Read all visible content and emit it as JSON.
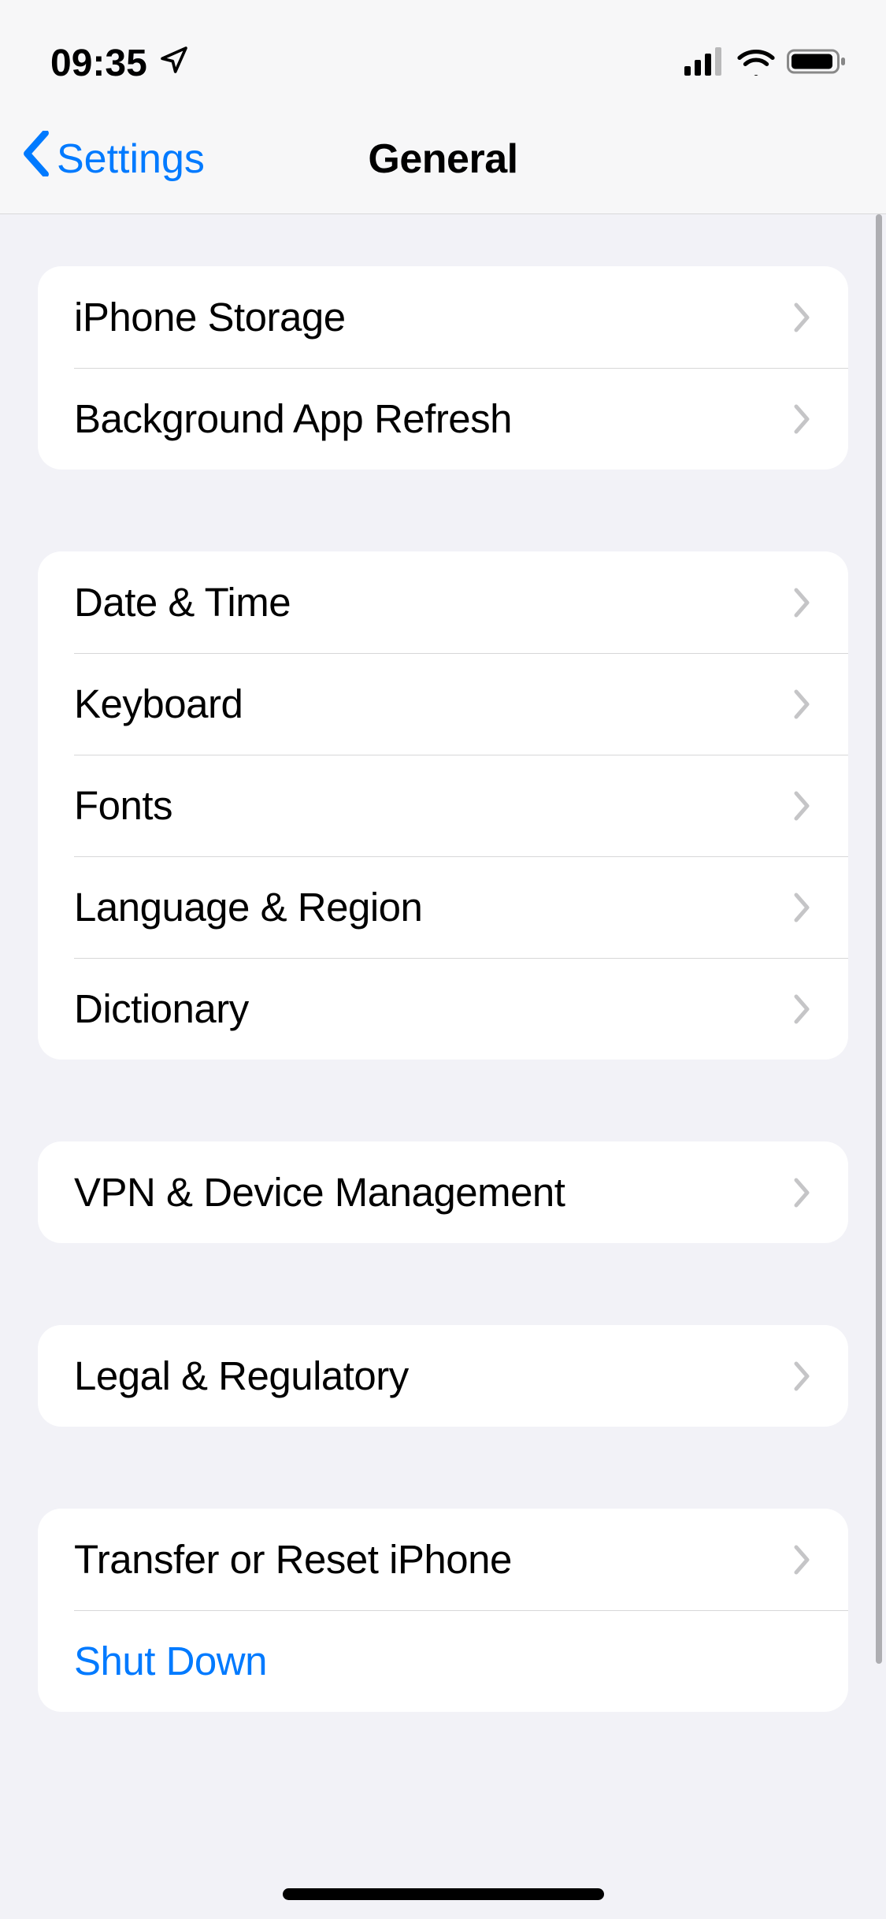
{
  "status": {
    "time": "09:35"
  },
  "nav": {
    "back_label": "Settings",
    "title": "General"
  },
  "groups": {
    "g1": {
      "iphone_storage": "iPhone Storage",
      "background_app_refresh": "Background App Refresh"
    },
    "g2": {
      "date_time": "Date & Time",
      "keyboard": "Keyboard",
      "fonts": "Fonts",
      "language_region": "Language & Region",
      "dictionary": "Dictionary"
    },
    "g3": {
      "vpn": "VPN & Device Management"
    },
    "g4": {
      "legal": "Legal & Regulatory"
    },
    "g5": {
      "transfer_reset": "Transfer or Reset iPhone",
      "shut_down": "Shut Down"
    }
  }
}
